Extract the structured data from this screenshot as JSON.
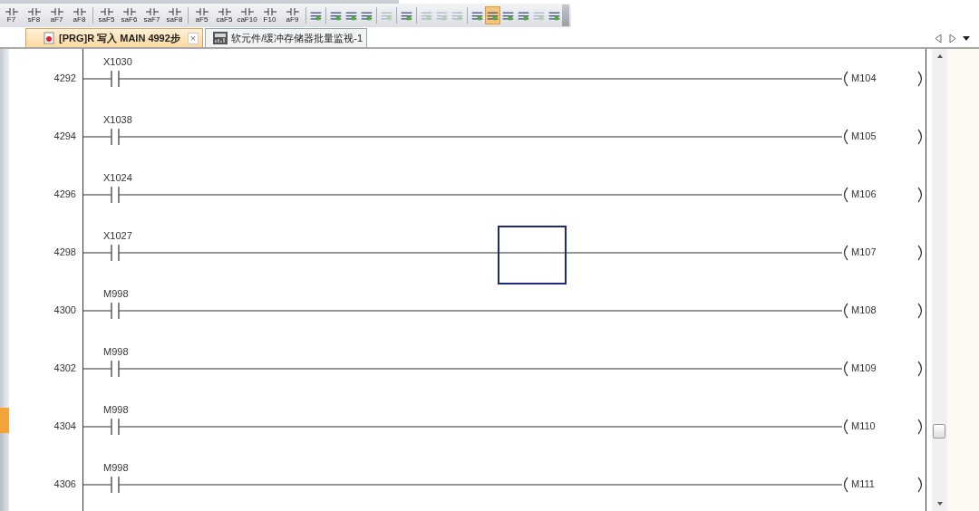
{
  "toolbar": [
    {
      "kind": "key",
      "label": "F7"
    },
    {
      "kind": "key",
      "label": "sF8"
    },
    {
      "kind": "key",
      "label": "aF7"
    },
    {
      "kind": "key",
      "label": "aF8"
    },
    {
      "kind": "sep"
    },
    {
      "kind": "key",
      "label": "saF5"
    },
    {
      "kind": "key",
      "label": "saF6"
    },
    {
      "kind": "key",
      "label": "saF7"
    },
    {
      "kind": "key",
      "label": "saF8"
    },
    {
      "kind": "sep"
    },
    {
      "kind": "key",
      "label": "aF5"
    },
    {
      "kind": "key",
      "label": "caF5"
    },
    {
      "kind": "key",
      "label": "caF10"
    },
    {
      "kind": "key",
      "label": "F10"
    },
    {
      "kind": "key",
      "label": "aF9"
    },
    {
      "kind": "sep"
    },
    {
      "kind": "icon",
      "active": false,
      "disabled": false
    },
    {
      "kind": "sep"
    },
    {
      "kind": "icon",
      "active": false,
      "disabled": false
    },
    {
      "kind": "icon",
      "active": false,
      "disabled": false
    },
    {
      "kind": "icon",
      "active": false,
      "disabled": false
    },
    {
      "kind": "sep"
    },
    {
      "kind": "icon",
      "active": false,
      "disabled": true
    },
    {
      "kind": "sep"
    },
    {
      "kind": "icon",
      "active": false,
      "disabled": false
    },
    {
      "kind": "sep"
    },
    {
      "kind": "icon",
      "active": false,
      "disabled": true
    },
    {
      "kind": "icon",
      "active": false,
      "disabled": true
    },
    {
      "kind": "icon",
      "active": false,
      "disabled": true
    },
    {
      "kind": "sep"
    },
    {
      "kind": "icon",
      "active": false,
      "disabled": false
    },
    {
      "kind": "icon",
      "active": true,
      "disabled": false
    },
    {
      "kind": "icon",
      "active": false,
      "disabled": false
    },
    {
      "kind": "icon",
      "active": false,
      "disabled": false
    },
    {
      "kind": "icon",
      "active": false,
      "disabled": true
    },
    {
      "kind": "icon",
      "active": false,
      "disabled": false
    }
  ],
  "tabs": [
    {
      "title": "[PRG]R 写入 MAIN 4992步",
      "close": "×",
      "selected": true
    },
    {
      "title": "软元件/缓冲存储器批量监视-1",
      "selected": false
    }
  ],
  "rungs": [
    {
      "step": "4292",
      "contact": "X1030",
      "coil": "M104",
      "selected": false
    },
    {
      "step": "4294",
      "contact": "X1038",
      "coil": "M105",
      "selected": false
    },
    {
      "step": "4296",
      "contact": "X1024",
      "coil": "M106",
      "selected": false
    },
    {
      "step": "4298",
      "contact": "X1027",
      "coil": "M107",
      "selected": true
    },
    {
      "step": "4300",
      "contact": "M998",
      "coil": "M108",
      "selected": false
    },
    {
      "step": "4302",
      "contact": "M998",
      "coil": "M109",
      "selected": false
    },
    {
      "step": "4304",
      "contact": "M998",
      "coil": "M110",
      "selected": false
    },
    {
      "step": "4306",
      "contact": "M998",
      "coil": "M111",
      "selected": false
    }
  ]
}
